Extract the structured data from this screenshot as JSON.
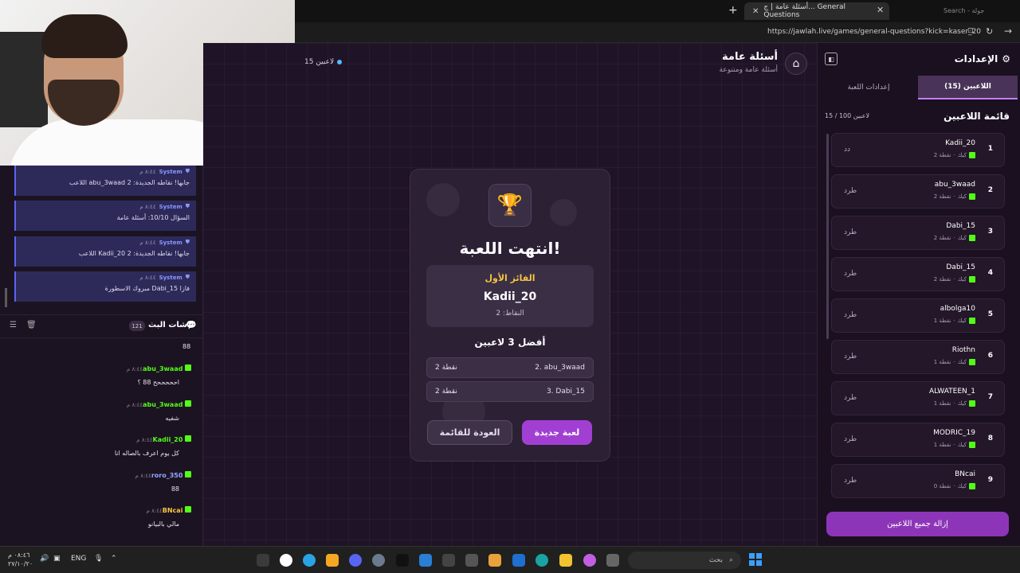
{
  "browser": {
    "tab_title": "أسئلة عامة | ج... General Questions",
    "new_tab": "+",
    "close": "✕",
    "search_hint": "Search - جولة",
    "url": "https://jawlah.live/games/general-questions?kick=kaser_20"
  },
  "header": {
    "title": "أسئلة عامة",
    "subtitle": "أسئلة عامة ومتنوعة",
    "players_online": "15 لاعبين"
  },
  "game_over": {
    "title": "انتهت اللعبة!",
    "winner_label": "الفائز الأول",
    "winner_name": "Kadii_20",
    "winner_points": "النقاط: 2",
    "top3_title": "أفضل 3 لاعبين",
    "top_rows": [
      {
        "name": "2. abu_3waad",
        "points": "2 نقطة"
      },
      {
        "name": "3. Dabi_15",
        "points": "2 نقطة"
      }
    ],
    "new_game_label": "لعبة جديدة",
    "back_label": "العودة للقائمة"
  },
  "sidebar": {
    "title": "الإعدادات",
    "tab_players": "اللاعبين (15)",
    "tab_settings": "إعدادات اللعبة",
    "list_title": "قائمة اللاعبين",
    "list_count": "15 / 100 لاعبين",
    "kick_label": "طرد",
    "platform": "كيك",
    "players": [
      {
        "rank": "1",
        "name": "Kadii_20",
        "points": "2 نقطة",
        "kick": "دد"
      },
      {
        "rank": "2",
        "name": "abu_3waad",
        "points": "2 نقطة",
        "kick": "طرد"
      },
      {
        "rank": "3",
        "name": "Dabi_15",
        "points": "2 نقطة",
        "kick": "طرد"
      },
      {
        "rank": "4",
        "name": "Dabi_15",
        "points": "2 نقطة",
        "kick": "طرد"
      },
      {
        "rank": "5",
        "name": "albolga10",
        "points": "1 نقطة",
        "kick": "طرد"
      },
      {
        "rank": "6",
        "name": "Riothn",
        "points": "1 نقطة",
        "kick": "طرد"
      },
      {
        "rank": "7",
        "name": "ALWATEEN_1",
        "points": "1 نقطة",
        "kick": "طرد"
      },
      {
        "rank": "8",
        "name": "MODRIC_19",
        "points": "1 نقطة",
        "kick": "طرد"
      },
      {
        "rank": "9",
        "name": "BNcai",
        "points": "0 نقطة",
        "kick": "طرد"
      }
    ],
    "remove_all_label": "إزالة جميع اللاعبين"
  },
  "chat": {
    "system_messages": [
      {
        "sender": "System",
        "time": "٨:٤٤ م",
        "text": "اللاعب abu_3waad جابها! نقاطه الجديدة: 2"
      },
      {
        "sender": "System",
        "time": "٨:٤٤ م",
        "text": "السؤال 10/10: أسئلة عامة"
      },
      {
        "sender": "System",
        "time": "٨:٤٤ م",
        "text": "اللاعب Kadii_20 جابها! نقاطه الجديدة: 2"
      },
      {
        "sender": "System",
        "time": "٨:٤٤ م",
        "text": "مبروك الاسطورة Dabi_15 فازا"
      }
    ],
    "title": "شات البث",
    "count": "121",
    "first_line": "88",
    "messages": [
      {
        "user": "abu_3waad",
        "time": "٨:٤٤ م",
        "text": "احححححح 88 ؟",
        "color": "#53fc18"
      },
      {
        "user": "abu_3waad",
        "time": "٨:٤٤ م",
        "text": "شفيه",
        "color": "#53fc18"
      },
      {
        "user": "Kadii_20",
        "time": "٨:٤٤ م",
        "text": "كل يوم اعرف بالصاله انا",
        "color": "#53fc18"
      },
      {
        "user": "roro_350",
        "time": "٨:٤٤ م",
        "text": "88",
        "color": "#8fa8ff"
      },
      {
        "user": "BNcai",
        "time": "٨:٤٤ م",
        "text": "مالي بالبيانو",
        "color": "#f5c542"
      }
    ]
  },
  "taskbar": {
    "time": "٠٨:٤٦ م",
    "date": "٢٧/١٠/٢٠",
    "lang": "ENG",
    "search_placeholder": "بحث"
  },
  "colors": {
    "accent": "#a23fd3",
    "winner": "#f5c542",
    "kick_green": "#53fc18",
    "system_blue": "#5865f2"
  }
}
